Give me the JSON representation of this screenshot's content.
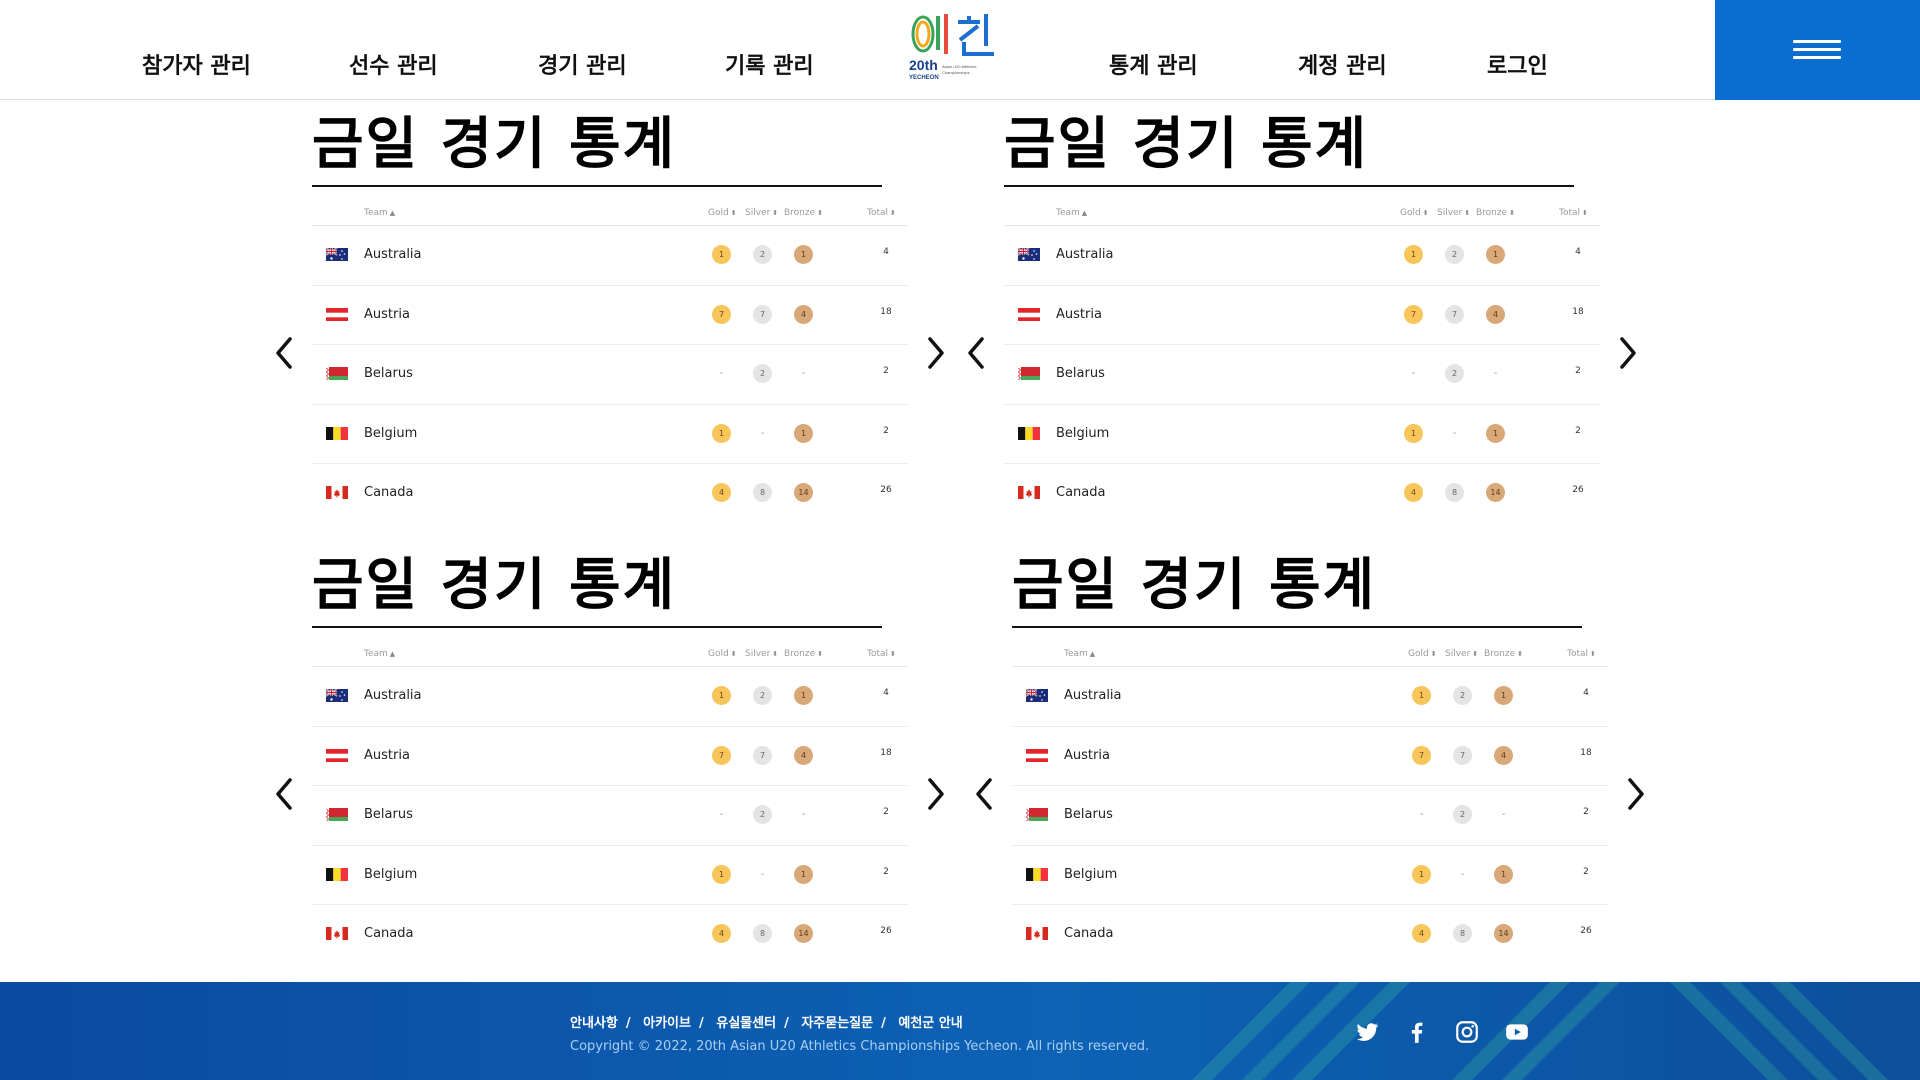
{
  "header": {
    "nav_left": [
      "참가자 관리",
      "선수 관리",
      "경기 관리",
      "기록 관리"
    ],
    "nav_right": [
      "통계 관리",
      "계정 관리",
      "로그인"
    ],
    "logo": {
      "text": "예천",
      "sub": "20th"
    }
  },
  "panels": [
    {
      "title": "금일 경기 통계"
    },
    {
      "title": "금일 경기 통계"
    },
    {
      "title": "금일 경기 통계"
    },
    {
      "title": "금일 경기 통계"
    }
  ],
  "table": {
    "headers": {
      "team": "Team",
      "gold": "Gold",
      "silver": "Silver",
      "bronze": "Bronze",
      "total": "Total"
    },
    "sort_icon": "⬍",
    "rows": [
      {
        "team": "Australia",
        "flag": "australia",
        "gold": "1",
        "silver": "2",
        "bronze": "1",
        "total": "4"
      },
      {
        "team": "Austria",
        "flag": "austria",
        "gold": "7",
        "silver": "7",
        "bronze": "4",
        "total": "18"
      },
      {
        "team": "Belarus",
        "flag": "belarus",
        "gold": "-",
        "silver": "2",
        "bronze": "-",
        "total": "2"
      },
      {
        "team": "Belgium",
        "flag": "belgium",
        "gold": "1",
        "silver": "-",
        "bronze": "1",
        "total": "2"
      },
      {
        "team": "Canada",
        "flag": "canada",
        "gold": "4",
        "silver": "8",
        "bronze": "14",
        "total": "26"
      }
    ]
  },
  "colors": {
    "accent": "#0a6ed1",
    "gold": "#f7c55a",
    "silver": "#e4e4e4",
    "bronze": "#d9a878",
    "footer": "#0d62b5"
  },
  "footer": {
    "links": [
      "안내사항",
      "아카이브",
      "유실물센터",
      "자주묻는질문",
      "예천군 안내"
    ],
    "copyright": "Copyright © 2022, 20th Asian U20 Athletics Championships Yecheon. All rights reserved.",
    "social": [
      "twitter-icon",
      "facebook-icon",
      "instagram-icon",
      "youtube-icon"
    ]
  }
}
